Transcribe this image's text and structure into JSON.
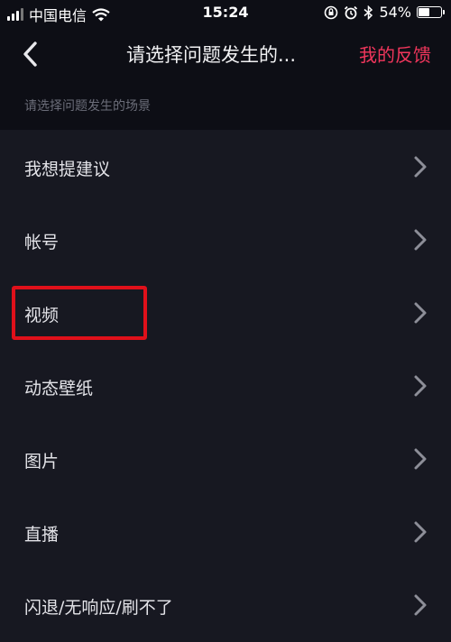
{
  "status_bar": {
    "carrier": "中国电信",
    "time": "15:24",
    "battery_percent": "54%",
    "battery_level": 0.54
  },
  "nav": {
    "title": "请选择问题发生的...",
    "right_action": "我的反馈"
  },
  "section_header": "请选择问题发生的场景",
  "items": [
    {
      "label": "我想提建议"
    },
    {
      "label": "帐号"
    },
    {
      "label": "视频"
    },
    {
      "label": "动态壁纸"
    },
    {
      "label": "图片"
    },
    {
      "label": "直播"
    },
    {
      "label": "闪退/无响应/刷不了"
    }
  ],
  "colors": {
    "background": "#171821",
    "accent": "#f1365c",
    "highlight": "#e0101a"
  }
}
